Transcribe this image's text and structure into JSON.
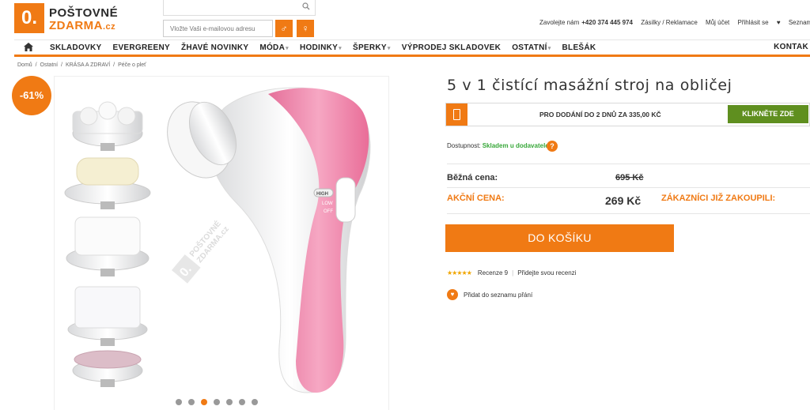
{
  "logo": {
    "badge": "0.",
    "line1": "POŠTOVNÉ",
    "line2": "ZDARMA",
    "tld": ".cz"
  },
  "search": {
    "icon": "search-icon"
  },
  "newsletter": {
    "placeholder": "Vložte Vaši e-mailovou adresu",
    "male_symbol": "♂",
    "female_symbol": "♀"
  },
  "topbar": {
    "call_label": "Zavolejte nám",
    "phone": "+420 374 445 974",
    "shipments": "Zásilky / Reklamace",
    "account": "Můj účet",
    "login": "Přihlásit se",
    "wishlist": "Seznam přá"
  },
  "nav": {
    "items": [
      {
        "label": "SKLADOVKY",
        "dropdown": false
      },
      {
        "label": "EVERGREENY",
        "dropdown": false
      },
      {
        "label": "ŽHAVÉ NOVINKY",
        "dropdown": false
      },
      {
        "label": "MÓDA",
        "dropdown": true
      },
      {
        "label": "HODINKY",
        "dropdown": true
      },
      {
        "label": "ŠPERKY",
        "dropdown": true
      },
      {
        "label": "VÝPRODEJ SKLADOVEK",
        "dropdown": false
      },
      {
        "label": "OSTATNÍ",
        "dropdown": true
      },
      {
        "label": "BLEŠÁK",
        "dropdown": false
      }
    ],
    "last": "KONTAK"
  },
  "breadcrumb": [
    "Domů",
    "Ostatní",
    "KRÁSA A ZDRAVÍ",
    "Péče o pleť"
  ],
  "product": {
    "discount": "-61%",
    "title": "5 v 1 čistící masážní stroj na obličej",
    "delivery_text": "PRO DODÁNÍ DO 2 DNŮ ZA 335,00 KČ",
    "click_here": "KLIKNĚTE ZDE",
    "availability_label": "Dostupnost:",
    "availability_value": "Skladem u dodavatele",
    "regular_label": "Běžná cena:",
    "regular_price": "695 Kč",
    "sale_label": "AKČNÍ CENA:",
    "sale_price": "269 Kč",
    "bought_label": "ZÁKAZNÍCI JIŽ ZAKOUPILI:",
    "add_to_cart": "DO KOŠÍKU",
    "stars": "★★★★★",
    "reviews": "Recenze 9",
    "add_review": "Přidejte svou recenzi",
    "wishlist": "Přidat do seznamu přání",
    "image_watermark": "POŠTOVNÉ ZDARMA.cz",
    "device_labels": [
      "HIGH",
      "LOW",
      "OFF"
    ],
    "gallery_dots": 7,
    "gallery_active": 3
  },
  "colors": {
    "accent": "#f07a14",
    "green_button": "#5f8f1f",
    "in_stock": "#38a83a",
    "device_pink": "#ef8fb0"
  }
}
